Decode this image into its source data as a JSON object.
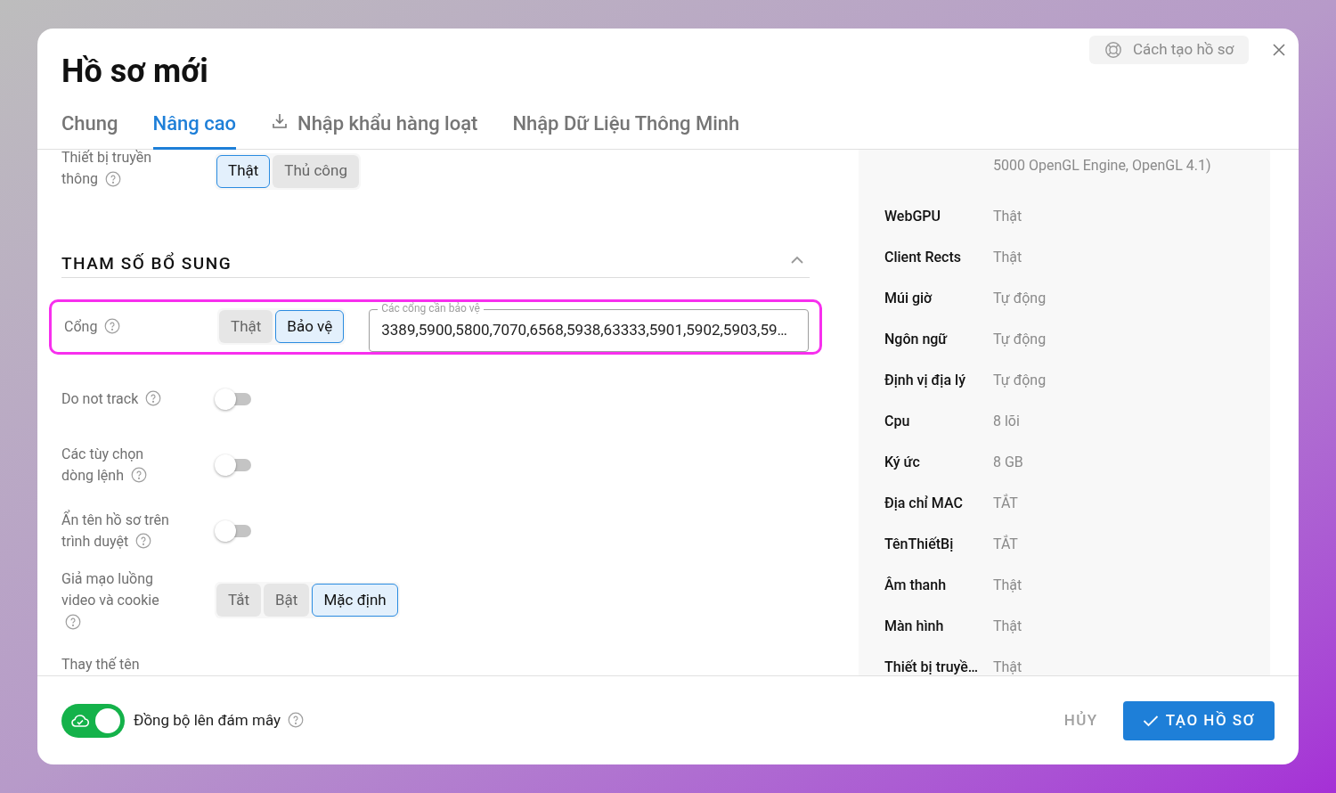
{
  "dialog": {
    "title": "Hồ sơ mới",
    "help_button": "Cách tạo hồ sơ"
  },
  "tabs": [
    {
      "label": "Chung",
      "selected": false,
      "kind": "plain"
    },
    {
      "label": "Nâng cao",
      "selected": true,
      "kind": "plain"
    },
    {
      "label": "Nhập khẩu hàng loạt",
      "selected": false,
      "kind": "import"
    },
    {
      "label": "Nhập Dữ Liệu Thông Minh",
      "selected": false,
      "kind": "plain"
    }
  ],
  "settings": [
    {
      "kind": "segmented",
      "label": "Thiết bị truyền thông",
      "options": [
        {
          "label": "Thật",
          "selected": true
        },
        {
          "label": "Thủ công",
          "selected": false
        }
      ]
    },
    {
      "kind": "section",
      "label": "THAM SỐ BỔ SUNG",
      "expanded": true
    },
    {
      "kind": "segmented",
      "label": "Cổng",
      "highlighted": true,
      "options": [
        {
          "label": "Thật",
          "selected": false
        },
        {
          "label": "Bảo vệ",
          "selected": true
        }
      ],
      "field": {
        "label": "Các cổng cần bảo vệ",
        "value": "3389,5900,5800,7070,6568,5938,63333,5901,5902,5903,59…"
      }
    },
    {
      "kind": "toggle",
      "label": "Do not track",
      "on": false
    },
    {
      "kind": "toggle",
      "label": "Các tùy chọn dòng lệnh",
      "on": false
    },
    {
      "kind": "toggle",
      "label": "Ẩn tên hồ sơ trên trình duyệt",
      "on": false
    },
    {
      "kind": "segmented",
      "label": "Giả mạo luồng video và cookie",
      "options": [
        {
          "label": "Tắt",
          "selected": false
        },
        {
          "label": "Bật",
          "selected": false
        },
        {
          "label": "Mặc định",
          "selected": true
        }
      ]
    },
    {
      "kind": "cut",
      "label": "Thay thế tên"
    }
  ],
  "summary": [
    {
      "value": "5000 OpenGL Engine, OpenGL 4.1)"
    },
    {
      "key": "WebGPU",
      "value": "Thật"
    },
    {
      "key": "Client Rects",
      "value": "Thật"
    },
    {
      "key": "Múi giờ",
      "value": "Tự động"
    },
    {
      "key": "Ngôn ngữ",
      "value": "Tự động"
    },
    {
      "key": "Định vị địa lý",
      "value": "Tự động"
    },
    {
      "key": "Cpu",
      "value": "8 lõi"
    },
    {
      "key": "Ký ức",
      "value": "8 GB"
    },
    {
      "key": "Địa chỉ MAC",
      "value": "TẮT"
    },
    {
      "key": "TênThiếtBị",
      "value": "TẮT"
    },
    {
      "key": "Âm thanh",
      "value": "Thật"
    },
    {
      "key": "Màn hình",
      "value": "Thật"
    },
    {
      "key": "Thiết bị truyề…",
      "value": "Thật"
    }
  ],
  "footer": {
    "sync": {
      "label": "Đồng bộ lên đám mây",
      "on": true
    },
    "cancel": "HỦY",
    "create": "TẠO HỒ SƠ"
  }
}
